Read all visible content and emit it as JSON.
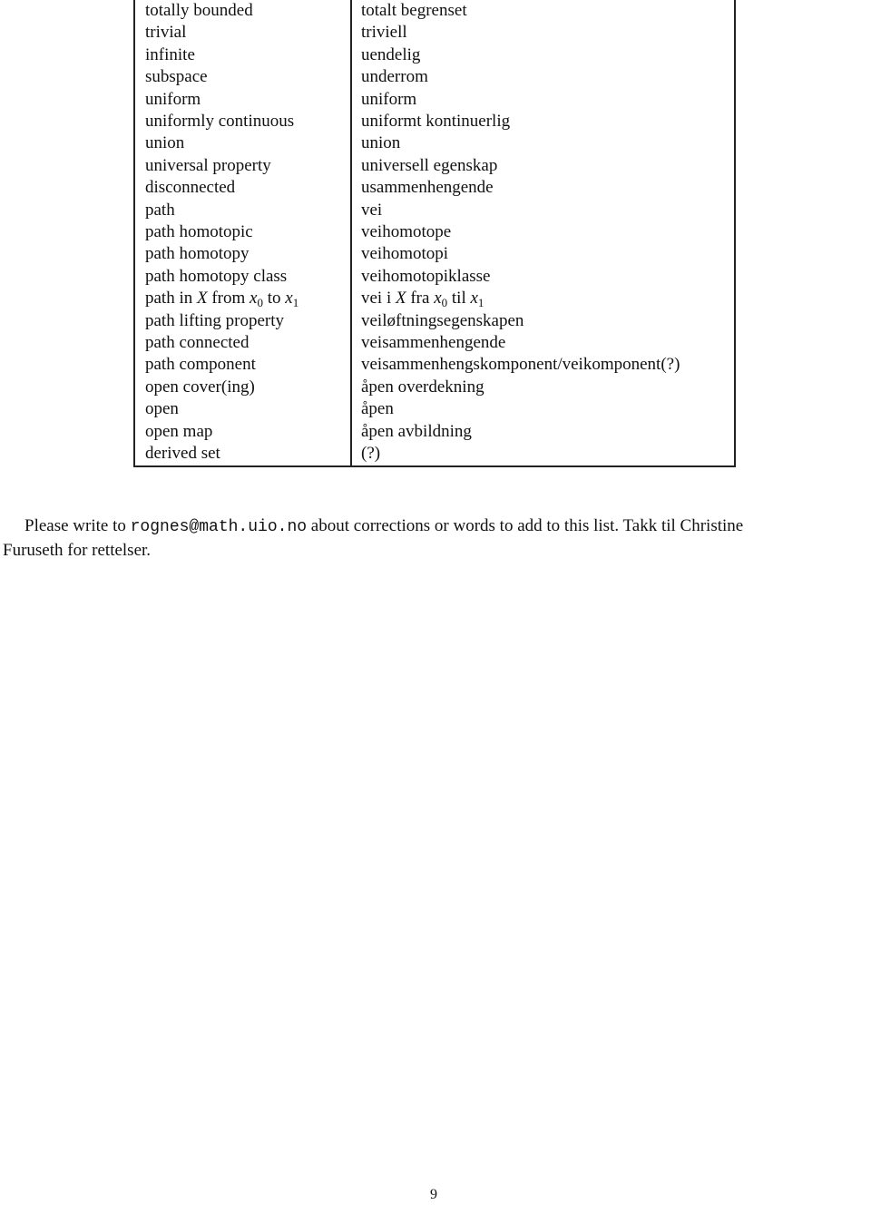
{
  "glossary": {
    "rows": [
      {
        "en": "totally bounded",
        "no": "totalt begrenset"
      },
      {
        "en": "trivial",
        "no": "triviell"
      },
      {
        "en": "infinite",
        "no": "uendelig"
      },
      {
        "en": "subspace",
        "no": "underrom"
      },
      {
        "en": "uniform",
        "no": "uniform"
      },
      {
        "en": "uniformly continuous",
        "no": "uniformt kontinuerlig"
      },
      {
        "en": "union",
        "no": "union"
      },
      {
        "en": "universal property",
        "no": "universell egenskap"
      },
      {
        "en": "disconnected",
        "no": "usammenhengende"
      },
      {
        "en": "path",
        "no": "vei"
      },
      {
        "en": "path homotopic",
        "no": "veihomotope"
      },
      {
        "en": "path homotopy",
        "no": "veihomotopi"
      },
      {
        "en": "path homotopy class",
        "no": "veihomotopiklasse"
      },
      {
        "en": "path in X from x0 to x1",
        "no": "vei i X fra x0 til x1"
      },
      {
        "en": "path lifting property",
        "no": "veiløftningsegenskapen"
      },
      {
        "en": "path connected",
        "no": "veisammenhengende"
      },
      {
        "en": "path component",
        "no": "veisammenhengskomponent/veikomponent(?)"
      },
      {
        "en": "open cover(ing)",
        "no": "åpen overdekning"
      },
      {
        "en": "open",
        "no": "åpen"
      },
      {
        "en": "open map",
        "no": "åpen avbildning"
      },
      {
        "en": "derived set",
        "no": "(?)"
      }
    ],
    "math_row": {
      "en": {
        "a": "path in ",
        "X": "X",
        "b": " from ",
        "x": "x",
        "s0": "0",
        "c": " to ",
        "s1": "1"
      },
      "no": {
        "a": "vei i ",
        "X": "X",
        "b": " fra ",
        "x": "x",
        "s0": "0",
        "c": " til ",
        "s1": "1"
      }
    }
  },
  "footer": {
    "before_email": "Please write to ",
    "email": "rognes@math.uio.no",
    "after_email": " about corrections or words to add to this list. Takk til Christine",
    "line2": "Furuseth for rettelser."
  },
  "page_number": "9"
}
